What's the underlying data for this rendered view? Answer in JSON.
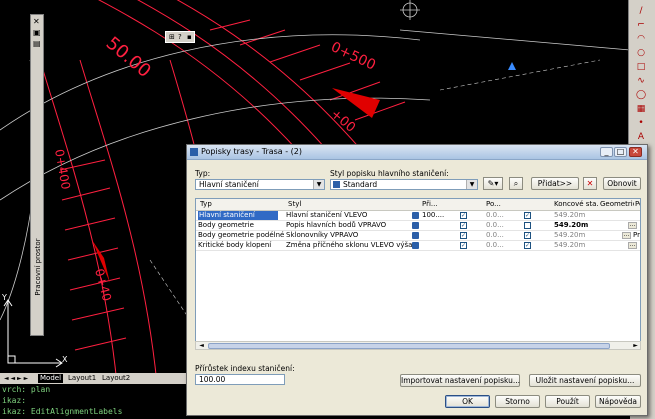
{
  "dialog": {
    "title": "Popisky trasy - Trasa - (2)",
    "type_label": "Typ:",
    "type_value": "Hlavní staničení",
    "style_label": "Styl popisku hlavního staničení:",
    "style_value": "Standard",
    "add_button": "Přidat>>",
    "refresh_button": "Obnovit",
    "table": {
      "columns": [
        "Typ",
        "Styl",
        "Při...",
        "Po...",
        "Koncové sta...",
        "Geometrické...",
        "Po"
      ],
      "rows": [
        {
          "type": "Hlavní staničení",
          "style": "Hlavní staničení VLEVO",
          "val": "100....",
          "po": "0.0...",
          "end": "549.20m",
          "extra": ""
        },
        {
          "type": "Body geometrie",
          "style": "Popis hlavních bodů VPRAVO",
          "val": "",
          "po": "0.0...",
          "end": "549.20m",
          "extra": ""
        },
        {
          "type": "Body geometrie podélného ...",
          "style": "Sklonovníky VPRAVO",
          "val": "",
          "po": "0.0...",
          "end": "549.20m",
          "extra": "Pro"
        },
        {
          "type": "Kritické body klopení",
          "style": "Změna příčného sklonu VLEVO výšař",
          "val": "",
          "po": "0.0...",
          "end": "549.20m",
          "extra": ""
        }
      ]
    },
    "increment_label": "Přírůstek indexu staničení:",
    "increment_value": "100.00",
    "import_button": "Importovat nastavení popisku...",
    "save_button": "Uložit nastavení popisku...",
    "ok_button": "OK",
    "cancel_button": "Storno",
    "apply_button": "Použít",
    "help_button": "Nápověda"
  },
  "palette": {
    "label": "Pracovní prostor"
  },
  "tabs": [
    "Model",
    "Layout1",
    "Layout2"
  ],
  "command_lines": [
    "vrch: plan",
    "ikaz:",
    "ikaz: EditAlignmentLabels"
  ],
  "cad": {
    "labels": [
      "0+500",
      "+00",
      "0+40",
      "0+400",
      "400",
      "50.00"
    ],
    "line_color": "#ff2040",
    "arrow_color": "#e00000",
    "drawing_bg": "#000000"
  },
  "icons": [
    "search-icon",
    "gear-icon",
    "close-icon",
    "help-icon"
  ]
}
